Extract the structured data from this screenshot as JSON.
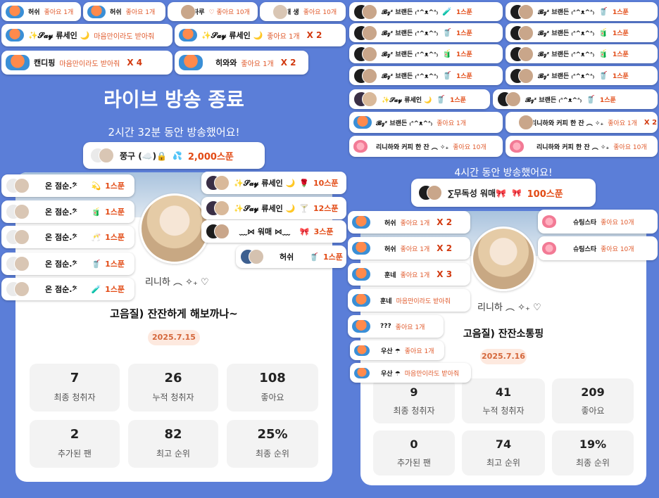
{
  "left": {
    "headline": "라이브 방송 종료",
    "duration": "2시간 32분 동안 방송했어요!",
    "top_gift": {
      "nick": "쭝구 (☁️)🔒",
      "amount": "2,000스푼"
    },
    "streamer_nick": "리니하 ︵ ✧₊ ♡",
    "broadcast_title": "고음질) 잔잔하게 해보까나~",
    "date": "2025.7.15",
    "stats": [
      {
        "value": "7",
        "label": "최종 청취자"
      },
      {
        "value": "26",
        "label": "누적 청취자"
      },
      {
        "value": "108",
        "label": "좋아요"
      },
      {
        "value": "2",
        "label": "추가된 팬"
      },
      {
        "value": "82",
        "label": "최고 순위"
      },
      {
        "value": "25%",
        "label": "최종 순위"
      }
    ],
    "top_pills": [
      {
        "nick": "허쉬",
        "msg": "좋아요 1개",
        "mult": ""
      },
      {
        "nick": "허쉬",
        "msg": "좋아요 1개",
        "mult": ""
      },
      {
        "nick": "하루",
        "msg": "♡ 좋아요 10개",
        "mult": ""
      },
      {
        "nick": "태 생",
        "msg": "좋아요 10개",
        "mult": ""
      },
      {
        "nick": "✨𝓢𝓪𝔂 류세인 🌙",
        "msg": "마음만이라도 받아줘",
        "mult": ""
      },
      {
        "nick": "✨𝓢𝓪𝔂 류세인 🌙",
        "msg": "좋아요 1개",
        "mult": "X 2"
      },
      {
        "nick": "캔디핑",
        "msg": "마음만이라도 받아줘",
        "mult": "X 4"
      },
      {
        "nick": "히와와",
        "msg": "좋아요 1개",
        "mult": "X 2"
      }
    ],
    "gift_pills": [
      {
        "nick": "온 점순.𝄢",
        "icon": "💫",
        "gift": "1스푼"
      },
      {
        "nick": "온 점순.𝄢",
        "icon": "🧃",
        "gift": "1스푼"
      },
      {
        "nick": "온 점순.𝄢",
        "icon": "🥂",
        "gift": "1스푼"
      },
      {
        "nick": "온 점순.𝄢",
        "icon": "🥤",
        "gift": "1스푼"
      },
      {
        "nick": "온 점순.𝄢",
        "icon": "🧪",
        "gift": "1스푼"
      },
      {
        "nick": "✨𝓢𝓪𝔂 류세인 🌙",
        "icon": "🌹",
        "gift": "10스푼"
      },
      {
        "nick": "✨𝓢𝓪𝔂 류세인 🌙",
        "icon": "🍸",
        "gift": "12스푼"
      },
      {
        "nick": "﹏⋈ 워매 ⋈﹏",
        "icon": "🎀",
        "gift": "3스푼"
      },
      {
        "nick": "허쉬",
        "icon": "🥤",
        "gift": "1스푼"
      }
    ]
  },
  "right": {
    "duration": "4시간 동안 방송했어요!",
    "top_gift": {
      "nick": "∑무독성 워매🎀",
      "amount": "100스푼"
    },
    "streamer_nick": "리니하 ︵ ✧₊ ♡",
    "broadcast_title": "고음질) 잔잔소통핑",
    "date": "2025.7.16",
    "stats": [
      {
        "value": "9",
        "label": "최종 청취자"
      },
      {
        "value": "41",
        "label": "누적 청취자"
      },
      {
        "value": "209",
        "label": "좋아요"
      },
      {
        "value": "0",
        "label": "추가된 팬"
      },
      {
        "value": "74",
        "label": "최고 순위"
      },
      {
        "value": "19%",
        "label": "최종 순위"
      }
    ],
    "brand_pills": [
      {
        "nick": "𝓑𝔃ᶻ 브랜든 ₍ᐢ^ᴥ^ᐢ₎",
        "icon": "🧪",
        "gift": "1스푼"
      },
      {
        "nick": "𝓑𝔃ᶻ 브랜든 ₍ᐢ^ᴥ^ᐢ₎",
        "icon": "🥤",
        "gift": "1스푼"
      },
      {
        "nick": "𝓑𝔃ᶻ 브랜든 ₍ᐢ^ᴥ^ᐢ₎",
        "icon": "🥤",
        "gift": "1스푼"
      },
      {
        "nick": "𝓑𝔃ᶻ 브랜든 ₍ᐢ^ᴥ^ᐢ₎",
        "icon": "🧃",
        "gift": "1스푼"
      },
      {
        "nick": "𝓑𝔃ᶻ 브랜든 ₍ᐢ^ᴥ^ᐢ₎",
        "icon": "🧃",
        "gift": "1스푼"
      },
      {
        "nick": "𝓑𝔃ᶻ 브랜든 ₍ᐢ^ᴥ^ᐢ₎",
        "icon": "🧃",
        "gift": "1스푼"
      },
      {
        "nick": "𝓑𝔃ᶻ 브랜든 ₍ᐢ^ᴥ^ᐢ₎",
        "icon": "🥤",
        "gift": "1스푼"
      },
      {
        "nick": "𝓑𝔃ᶻ 브랜든 ₍ᐢ^ᴥ^ᐢ₎",
        "icon": "🥤",
        "gift": "1스푼"
      },
      {
        "nick": "✨𝓢𝓪𝔂 류세인 🌙",
        "icon": "🥤",
        "gift": "1스푼"
      },
      {
        "nick": "𝓑𝔃ᶻ 브랜든 ₍ᐢ^ᴥ^ᐢ₎",
        "icon": "🥤",
        "gift": "1스푼"
      }
    ],
    "like_pills": [
      {
        "nick": "𝓑𝔃ᶻ 브랜든 ₍ᐢ^ᴥ^ᐢ₎",
        "msg": "좋아요 1개",
        "mult": ""
      },
      {
        "nick": "리니하와 커피 한 잔 ︵ ✧₊",
        "msg": "좋아요 1개",
        "mult": "X 2"
      },
      {
        "nick": "리니하와 커피 한 잔 ︵ ✧₊",
        "msg": "좋아요 10개",
        "mult": ""
      },
      {
        "nick": "리니하와 커피 한 잔 ︵ ✧₊",
        "msg": "좋아요 10개",
        "mult": ""
      }
    ],
    "lower_pills": [
      {
        "nick": "허쉬",
        "msg": "좋아요 1개",
        "mult": "X 2"
      },
      {
        "nick": "허쉬",
        "msg": "좋아요 1개",
        "mult": "X 2"
      },
      {
        "nick": "훈네",
        "msg": "좋아요 1개",
        "mult": "X 3"
      },
      {
        "nick": "훈네",
        "msg": "마음만이라도 받아줘",
        "mult": ""
      },
      {
        "nick": "???",
        "msg": "좋아요 1개",
        "mult": ""
      },
      {
        "nick": "우산 ☂",
        "msg": "좋아요 1개",
        "mult": ""
      },
      {
        "nick": "우산 ☂",
        "msg": "마음만이라도 받아줘",
        "mult": ""
      }
    ],
    "side_pills": [
      {
        "nick": "슈팅스타",
        "msg": "좋아요 10개"
      },
      {
        "nick": "슈팅스타",
        "msg": "좋아요 10개"
      }
    ]
  }
}
